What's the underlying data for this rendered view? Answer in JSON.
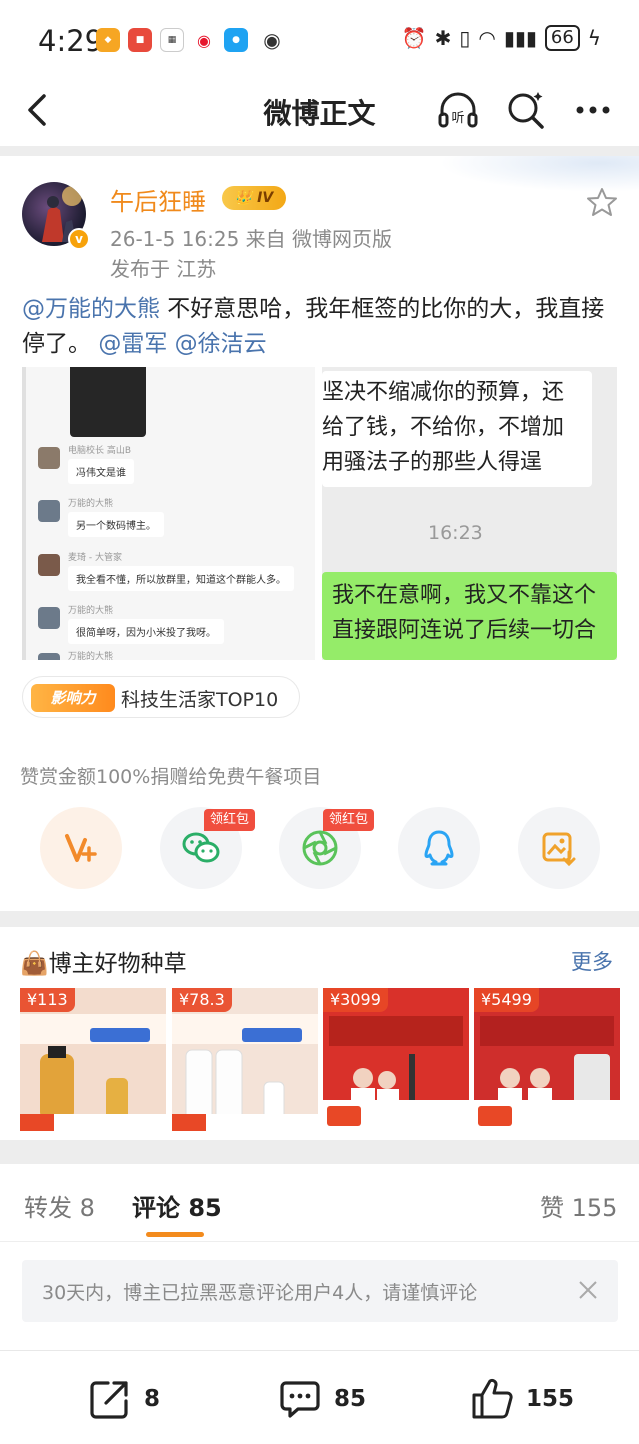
{
  "status_bar": {
    "time": "4:29",
    "battery": "66"
  },
  "nav": {
    "title": "微博正文"
  },
  "post": {
    "username": "午后狂睡",
    "level": "IV",
    "date_source": "26-1-5 16:25  来自 微博网页版",
    "location": "发布于 江苏",
    "text": {
      "mention1": "@万能的大熊",
      "body": " 不好意思哈，我年框签的比你的大，我直接停了。",
      "mention2": "@雷军",
      "mention3": "@徐洁云"
    },
    "image1": {
      "chats": [
        {
          "name": "电脑校长 高山B",
          "msg": "冯伟文是谁"
        },
        {
          "name": "万能的大熊",
          "msg": "另一个数码博主。"
        },
        {
          "name": "麦琦 - 大管家",
          "msg": "我全看不懂，所以放群里，知道这个群能人多。"
        },
        {
          "name": "万能的大熊",
          "msg": "很简单呀，因为小米投了我呀。"
        },
        {
          "name": "万能的大熊",
          "msg": ""
        }
      ]
    },
    "image2": {
      "white_lines": [
        "坚决不缩减你的预算，还",
        "给了钱，不给你，不增加",
        "用骚法子的那些人得逞"
      ],
      "time": "16:23",
      "green_lines": [
        "我不在意啊，我又不靠这个",
        "直接跟阿连说了后续一切合"
      ]
    },
    "influence_tag": {
      "badge": "影响力",
      "label": "科技生活家TOP10"
    },
    "donate_text": "赞赏金额100%捐赠给免费午餐项目",
    "share_actions": [
      {
        "icon": "reward-v-icon"
      },
      {
        "icon": "wechat-icon",
        "tag": "领红包"
      },
      {
        "icon": "moments-icon",
        "tag": "领红包"
      },
      {
        "icon": "qq-icon"
      },
      {
        "icon": "save-image-icon"
      }
    ]
  },
  "shop": {
    "title": "博主好物种草",
    "more": "更多",
    "products": [
      {
        "price": "¥113",
        "bg": "#f3dccd"
      },
      {
        "price": "¥78.3",
        "bg": "#f4e3d8"
      },
      {
        "price": "¥3099",
        "bg": "#d9312a"
      },
      {
        "price": "¥5499",
        "bg": "#cf2e2c"
      }
    ]
  },
  "tabs": {
    "repost": "转发 8",
    "comment": "评论 85",
    "like": "赞 155"
  },
  "notice": "30天内，博主已拉黑恶意评论用户4人，请谨慎评论",
  "bottom_bar": {
    "repost_count": "8",
    "comment_count": "85",
    "like_count": "155"
  },
  "colors": {
    "accent": "#f38b1d",
    "link": "#4a74ad",
    "username": "#f08a1c",
    "red_tag": "#f04e3e"
  }
}
